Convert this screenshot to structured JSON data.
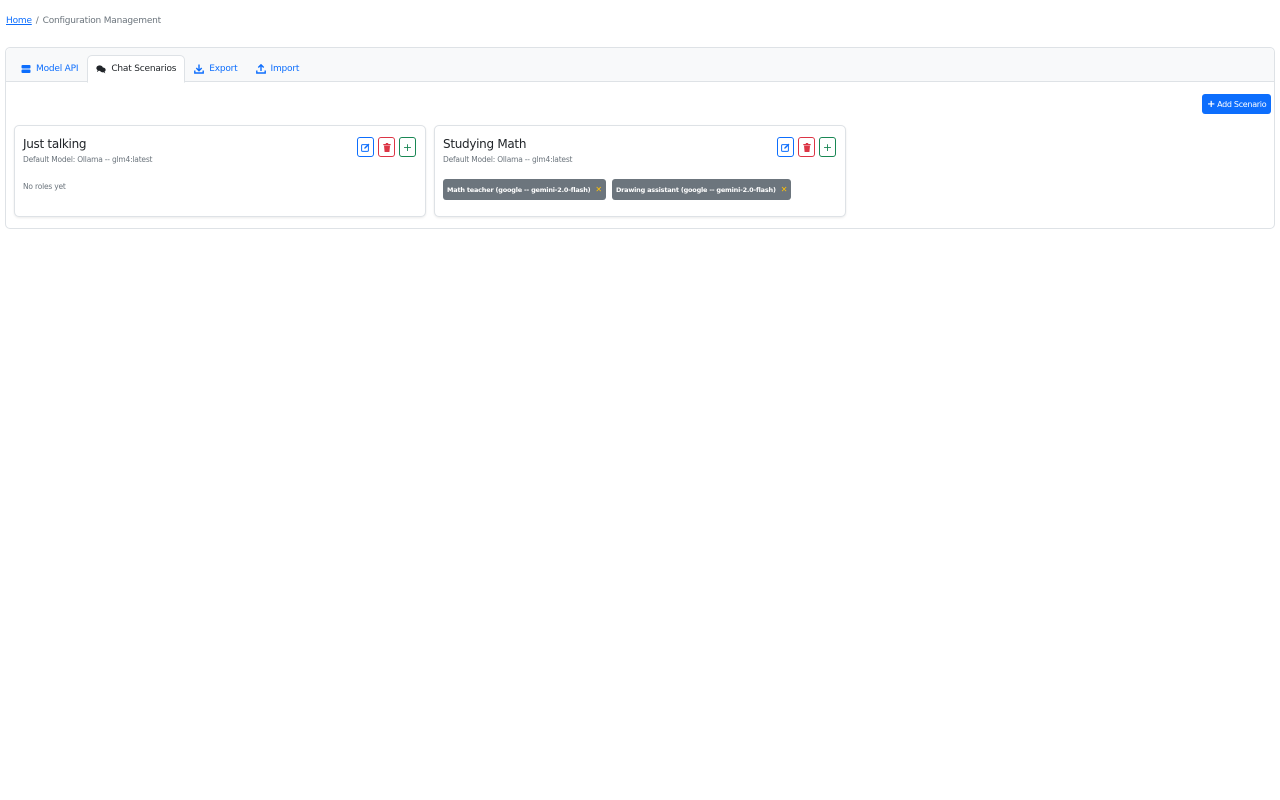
{
  "breadcrumb": {
    "home": "Home",
    "separator": "/",
    "current": "Configuration Management"
  },
  "tabs": [
    {
      "label": "Model API",
      "icon": "server-icon",
      "active": false
    },
    {
      "label": "Chat Scenarios",
      "icon": "chat-dots-icon",
      "active": true
    },
    {
      "label": "Export",
      "icon": "download-icon",
      "active": false
    },
    {
      "label": "Import",
      "icon": "upload-icon",
      "active": false
    }
  ],
  "add_scenario_label": "Add Scenario",
  "scenarios": [
    {
      "title": "Just talking",
      "default_model": "Default Model: Ollama -- glm4:latest",
      "empty_roles": "No roles yet",
      "roles": []
    },
    {
      "title": "Studying Math",
      "default_model": "Default Model: Ollama -- glm4:latest",
      "roles": [
        {
          "label": "Math teacher (google -- gemini-2.0-flash)"
        },
        {
          "label": "Drawing assistant (google -- gemini-2.0-flash)"
        }
      ]
    }
  ],
  "colors": {
    "primary": "#0d6efd",
    "danger": "#dc3545",
    "success": "#198754",
    "badge": "#6c757d",
    "badge_close": "#ffc107"
  }
}
